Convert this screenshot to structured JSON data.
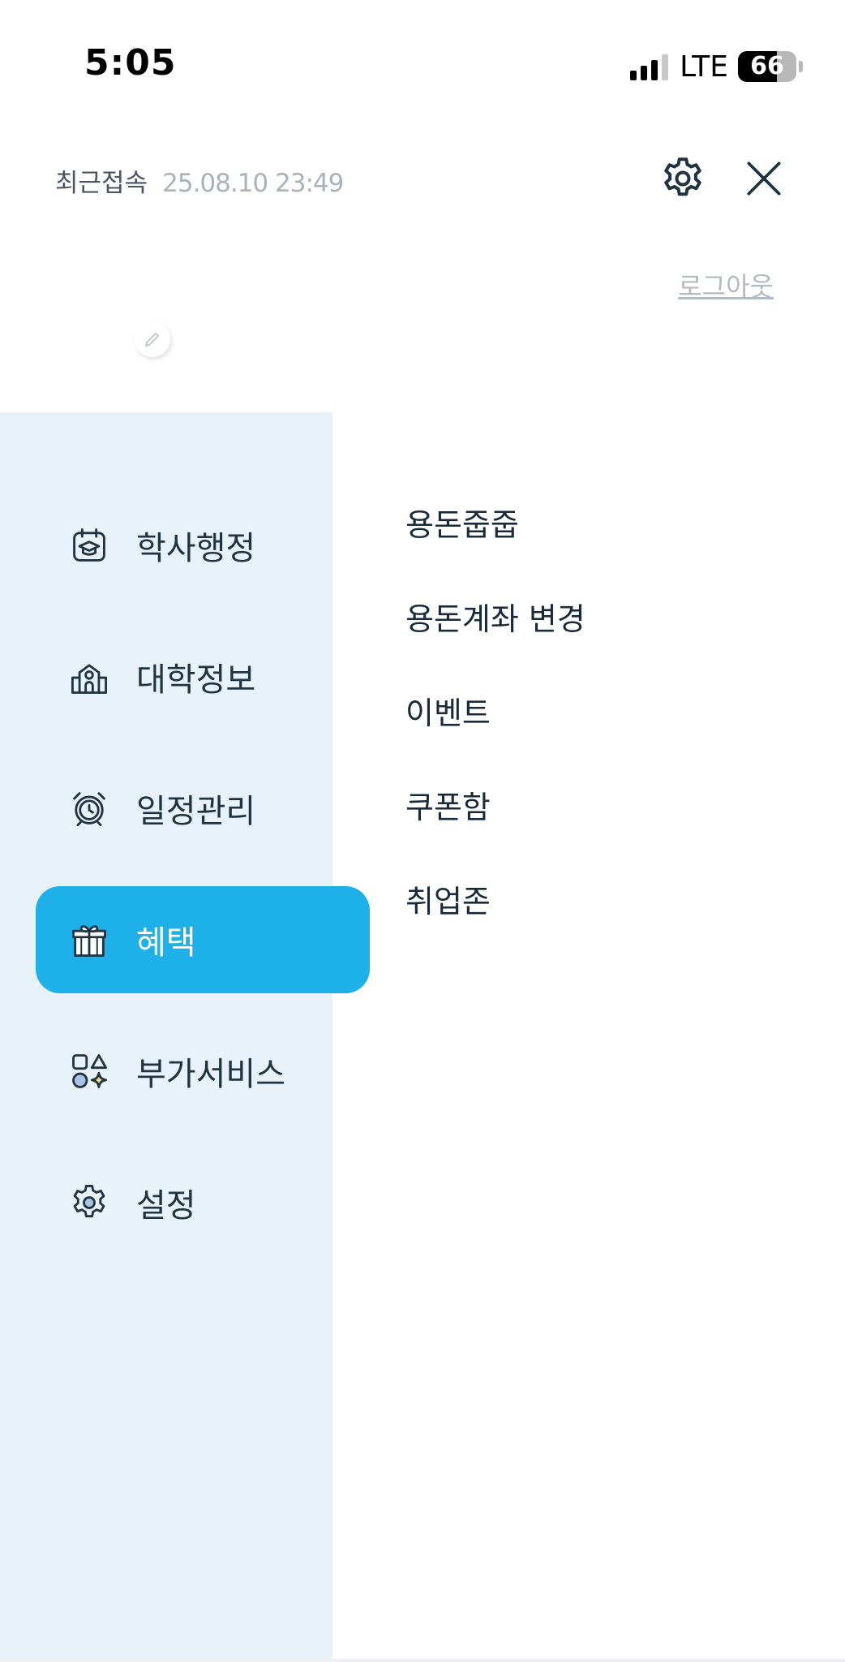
{
  "status_bar": {
    "time": "5:05",
    "network": "LTE",
    "battery_percent": 66,
    "battery_label": "66"
  },
  "header": {
    "last_login_label": "최근접속",
    "last_login_value": "25.08.10 23:49",
    "logout_label": "로그아웃",
    "settings_icon": "gear-icon",
    "close_icon": "close-icon"
  },
  "categories": [
    {
      "label": "학사행정",
      "icon": "calendar-graduation-icon",
      "active": false
    },
    {
      "label": "대학정보",
      "icon": "university-icon",
      "active": false
    },
    {
      "label": "일정관리",
      "icon": "alarm-clock-icon",
      "active": false
    },
    {
      "label": "혜택",
      "icon": "gift-icon",
      "active": true
    },
    {
      "label": "부가서비스",
      "icon": "shapes-sparkle-icon",
      "active": false
    },
    {
      "label": "설정",
      "icon": "gear-icon",
      "active": false
    }
  ],
  "submenu": [
    {
      "label": "용돈줍줍"
    },
    {
      "label": "용돈계좌 변경"
    },
    {
      "label": "이벤트"
    },
    {
      "label": "쿠폰함"
    },
    {
      "label": "취업존"
    }
  ],
  "colors": {
    "accent": "#1eb0e8",
    "sidebar_bg": "#e7f2fb",
    "text_dark": "#1f3340",
    "text_muted": "#a9b2bd"
  }
}
